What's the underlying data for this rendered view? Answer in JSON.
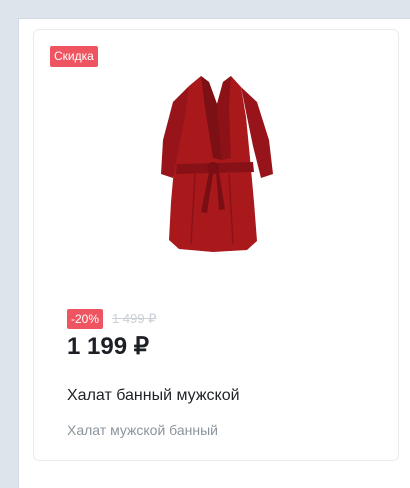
{
  "product": {
    "badge": "Скидка",
    "discount": "-20%",
    "old_price": "1 499 ₽",
    "price": "1 199 ₽",
    "title": "Халат банный мужской",
    "subtitle": "Халат мужской банный",
    "image_icon": "red-bathrobe-icon",
    "color": "#a9191c"
  },
  "colors": {
    "badge": "#ee5561",
    "page_bg": "#dde4ec"
  }
}
